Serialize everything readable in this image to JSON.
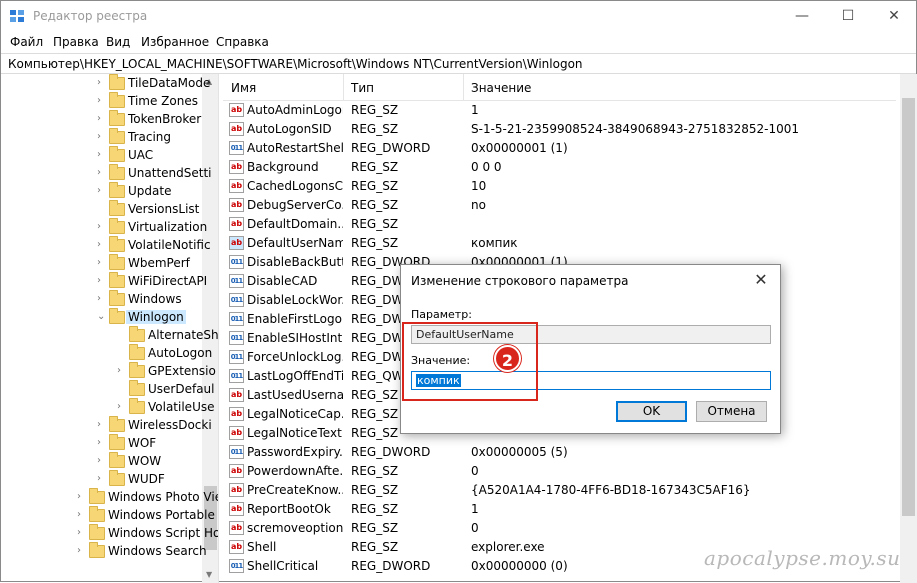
{
  "window": {
    "title": "Редактор реестра",
    "controls": [
      "—",
      "☐",
      "✕"
    ]
  },
  "menu": [
    "Файл",
    "Правка",
    "Вид",
    "Избранное",
    "Справка"
  ],
  "address": "Компьютер\\HKEY_LOCAL_MACHINE\\SOFTWARE\\Microsoft\\Windows NT\\CurrentVersion\\Winlogon",
  "tree": [
    {
      "label": "TileDataMode",
      "level": 1,
      "expandable": true
    },
    {
      "label": "Time Zones",
      "level": 1,
      "expandable": true
    },
    {
      "label": "TokenBroker",
      "level": 1,
      "expandable": true
    },
    {
      "label": "Tracing",
      "level": 1,
      "expandable": true
    },
    {
      "label": "UAC",
      "level": 1,
      "expandable": true
    },
    {
      "label": "UnattendSetti",
      "level": 1,
      "expandable": true
    },
    {
      "label": "Update",
      "level": 1,
      "expandable": true
    },
    {
      "label": "VersionsList",
      "level": 1,
      "expandable": false
    },
    {
      "label": "Virtualization",
      "level": 1,
      "expandable": true
    },
    {
      "label": "VolatileNotific",
      "level": 1,
      "expandable": true
    },
    {
      "label": "WbemPerf",
      "level": 1,
      "expandable": true
    },
    {
      "label": "WiFiDirectAPI",
      "level": 1,
      "expandable": true
    },
    {
      "label": "Windows",
      "level": 1,
      "expandable": true
    },
    {
      "label": "Winlogon",
      "level": 1,
      "expandable": true,
      "expanded": true,
      "selected": true
    },
    {
      "label": "AlternateSh",
      "level": 2,
      "expandable": false
    },
    {
      "label": "AutoLogon",
      "level": 2,
      "expandable": false
    },
    {
      "label": "GPExtensio",
      "level": 2,
      "expandable": true
    },
    {
      "label": "UserDefaul",
      "level": 2,
      "expandable": false
    },
    {
      "label": "VolatileUse",
      "level": 2,
      "expandable": true
    },
    {
      "label": "WirelessDocki",
      "level": 1,
      "expandable": true
    },
    {
      "label": "WOF",
      "level": 1,
      "expandable": true
    },
    {
      "label": "WOW",
      "level": 1,
      "expandable": true
    },
    {
      "label": "WUDF",
      "level": 1,
      "expandable": true
    },
    {
      "label": "Windows Photo Viev",
      "level": 0,
      "expandable": true
    },
    {
      "label": "Windows Portable D",
      "level": 0,
      "expandable": true
    },
    {
      "label": "Windows Script Hos",
      "level": 0,
      "expandable": true
    },
    {
      "label": "Windows Search",
      "level": 0,
      "expandable": true
    }
  ],
  "columns": [
    "Имя",
    "Тип",
    "Значение"
  ],
  "rows": [
    {
      "icon": "ab",
      "name": "AutoAdminLogon",
      "type": "REG_SZ",
      "data": "1"
    },
    {
      "icon": "ab",
      "name": "AutoLogonSID",
      "type": "REG_SZ",
      "data": "S-1-5-21-2359908524-3849068943-2751832852-1001"
    },
    {
      "icon": "bin",
      "name": "AutoRestartShell",
      "type": "REG_DWORD",
      "data": "0x00000001 (1)"
    },
    {
      "icon": "ab",
      "name": "Background",
      "type": "REG_SZ",
      "data": "0 0 0"
    },
    {
      "icon": "ab",
      "name": "CachedLogonsC...",
      "type": "REG_SZ",
      "data": "10"
    },
    {
      "icon": "ab",
      "name": "DebugServerCo...",
      "type": "REG_SZ",
      "data": "no"
    },
    {
      "icon": "ab",
      "name": "DefaultDomain...",
      "type": "REG_SZ",
      "data": ""
    },
    {
      "icon": "ab-sel",
      "name": "DefaultUserName",
      "type": "REG_SZ",
      "data": "компик"
    },
    {
      "icon": "bin",
      "name": "DisableBackButt...",
      "type": "REG_DWORD",
      "data": "0x00000001 (1)"
    },
    {
      "icon": "bin",
      "name": "DisableCAD",
      "type": "REG_DWORD",
      "data": ""
    },
    {
      "icon": "bin",
      "name": "DisableLockWor...",
      "type": "REG_DWORD",
      "data": ""
    },
    {
      "icon": "bin",
      "name": "EnableFirstLogo...",
      "type": "REG_DWORD",
      "data": ""
    },
    {
      "icon": "bin",
      "name": "EnableSIHostInt...",
      "type": "REG_DWORD",
      "data": ""
    },
    {
      "icon": "bin",
      "name": "ForceUnlockLog...",
      "type": "REG_DWORD",
      "data": ""
    },
    {
      "icon": "bin",
      "name": "LastLogOffEndTi...",
      "type": "REG_QWORD",
      "data": ""
    },
    {
      "icon": "ab",
      "name": "LastUsedUserna...",
      "type": "REG_SZ",
      "data": ""
    },
    {
      "icon": "ab",
      "name": "LegalNoticeCap...",
      "type": "REG_SZ",
      "data": ""
    },
    {
      "icon": "ab",
      "name": "LegalNoticeText",
      "type": "REG_SZ",
      "data": ""
    },
    {
      "icon": "bin",
      "name": "PasswordExpiry...",
      "type": "REG_DWORD",
      "data": "0x00000005 (5)"
    },
    {
      "icon": "ab",
      "name": "PowerdownAfte...",
      "type": "REG_SZ",
      "data": "0"
    },
    {
      "icon": "ab",
      "name": "PreCreateKnow...",
      "type": "REG_SZ",
      "data": "{A520A1A4-1780-4FF6-BD18-167343C5AF16}"
    },
    {
      "icon": "ab",
      "name": "ReportBootOk",
      "type": "REG_SZ",
      "data": "1"
    },
    {
      "icon": "ab",
      "name": "scremoveoption",
      "type": "REG_SZ",
      "data": "0"
    },
    {
      "icon": "ab",
      "name": "Shell",
      "type": "REG_SZ",
      "data": "explorer.exe"
    },
    {
      "icon": "bin",
      "name": "ShellCritical",
      "type": "REG_DWORD",
      "data": "0x00000000 (0)"
    }
  ],
  "dialog": {
    "title": "Изменение строкового параметра",
    "close": "✕",
    "param_label": "Параметр:",
    "param_value": "DefaultUserName",
    "value_label": "Значение:",
    "value": "компик",
    "ok": "OK",
    "cancel": "Отмена"
  },
  "annotation": {
    "step": "2",
    "color": "#d9261c"
  },
  "watermark": "apocalypse.moy.su"
}
